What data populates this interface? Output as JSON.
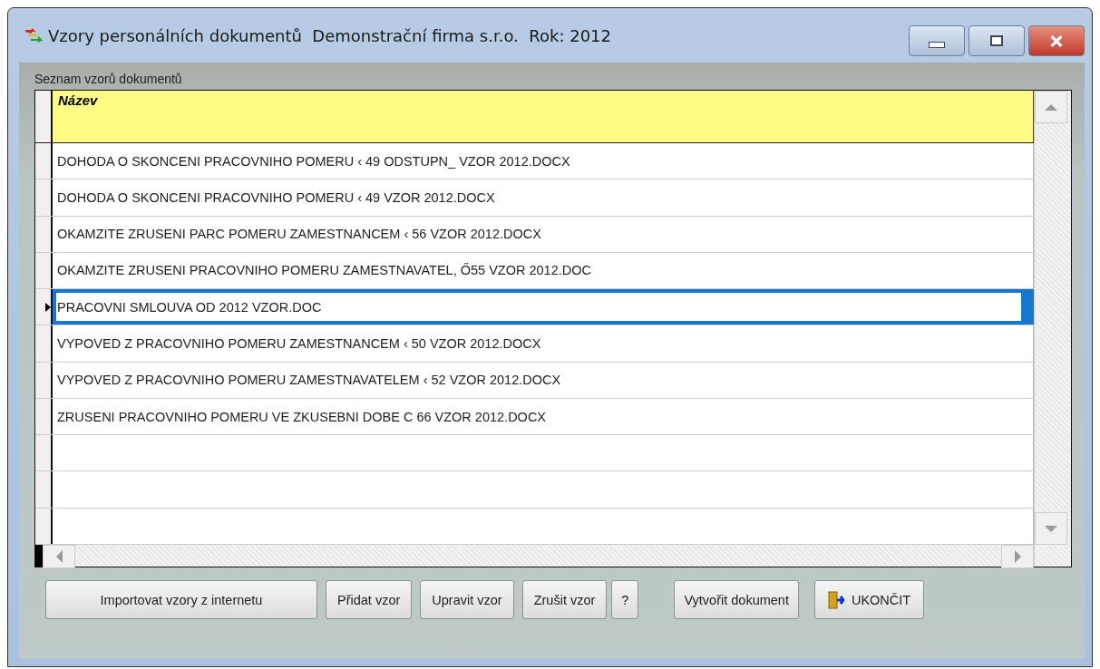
{
  "window": {
    "title": "Vzory personálních dokumentů  Demonstrační firma s.r.o.  Rok: 2012"
  },
  "list_label": "Seznam vzorů dokumentů",
  "table": {
    "columns": [
      "Název"
    ],
    "rows": [
      {
        "name": "DOHODA O SKONCENI PRACOVNIHO POMERU ‹ 49 ODSTUPN_ VZOR 2012.DOCX",
        "selected": false
      },
      {
        "name": "DOHODA O SKONCENI PRACOVNIHO POMERU ‹ 49 VZOR 2012.DOCX",
        "selected": false
      },
      {
        "name": "OKAMZITE ZRUSENI PARC POMERU ZAMESTNANCEM ‹ 56 VZOR 2012.DOCX",
        "selected": false
      },
      {
        "name": "OKAMZITE ZRUSENI PRACOVNIHO POMERU ZAMESTNAVATEL, Ő55 VZOR 2012.DOC",
        "selected": false
      },
      {
        "name": "PRACOVNI SMLOUVA OD 2012 VZOR.DOC",
        "selected": true
      },
      {
        "name": "VYPOVED Z PRACOVNIHO POMERU ZAMESTNANCEM ‹ 50 VZOR 2012.DOCX",
        "selected": false
      },
      {
        "name": "VYPOVED Z PRACOVNIHO POMERU ZAMESTNAVATELEM ‹ 52 VZOR 2012.DOCX",
        "selected": false
      },
      {
        "name": "ZRUSENI PRACOVNIHO POMERU VE ZKUSEBNI DOBE C 66 VZOR 2012.DOCX",
        "selected": false
      }
    ]
  },
  "buttons": [
    {
      "label": "Importovat vzory z internetu",
      "kind": "wide"
    },
    {
      "label": "Přidat vzor",
      "kind": "plain"
    },
    {
      "label": "Upravit vzor",
      "kind": "plain"
    },
    {
      "label": "Zrušit vzor",
      "kind": "plain"
    },
    {
      "label": "?",
      "kind": "small"
    },
    {
      "label": "Vytvořit dokument",
      "kind": "gap"
    },
    {
      "label": "UKONČIT",
      "kind": "exit"
    }
  ]
}
